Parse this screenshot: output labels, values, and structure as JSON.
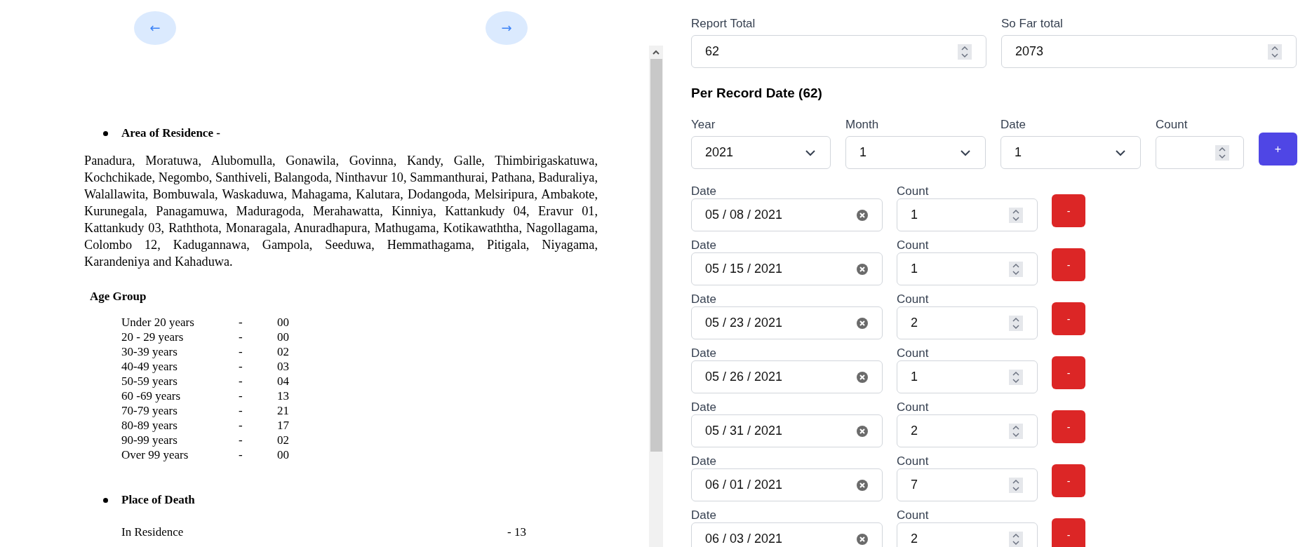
{
  "nav": {
    "prev": "←",
    "next": "→"
  },
  "document": {
    "residence": {
      "heading": "Area of Residence -",
      "text": "Panadura, Moratuwa, Alubomulla, Gonawila, Govinna, Kandy, Galle, Thimbirigaskatuwa, Kochchikade, Negombo, Santhiveli, Balangoda, Ninthavur 10, Sammanthurai, Pathana, Baduraliya, Walallawita, Bombuwala, Waskaduwa, Mahagama, Kalutara, Dodangoda, Melsiripura, Ambakote, Kurunegala, Panagamuwa, Maduragoda, Merahawatta, Kinniya, Kattankudy 04, Eravur 01, Kattankudy 03, Raththota, Monaragala, Anuradhapura, Mathugama, Kotikawaththa, Nagollagama, Colombo 12, Kadugannawa, Gampola, Seeduwa, Hemmathagama, Pitigala, Niyagama, Karandeniya and Kahaduwa."
    },
    "age_group": {
      "heading": "Age Group",
      "rows": [
        {
          "label": "Under 20 years",
          "dash": "-",
          "value": "00"
        },
        {
          "label": "20 - 29 years",
          "dash": "-",
          "value": "00"
        },
        {
          "label": "30-39 years",
          "dash": "-",
          "value": "02"
        },
        {
          "label": "40-49 years",
          "dash": "-",
          "value": "03"
        },
        {
          "label": "50-59 years",
          "dash": "-",
          "value": "04"
        },
        {
          "label": "60 -69 years",
          "dash": "-",
          "value": "13"
        },
        {
          "label": "70-79 years",
          "dash": "-",
          "value": "21"
        },
        {
          "label": "80-89 years",
          "dash": "-",
          "value": "17"
        },
        {
          "label": "90-99 years",
          "dash": "-",
          "value": "02"
        },
        {
          "label": "Over 99 years",
          "dash": "-",
          "value": "00"
        }
      ]
    },
    "place_of_death": {
      "heading": "Place of Death",
      "rows": [
        {
          "label": "In Residence",
          "value": "- 13"
        }
      ]
    }
  },
  "form": {
    "totals": [
      {
        "label": "Report Total",
        "value": "62"
      },
      {
        "label": "So Far total",
        "value": "2073"
      }
    ],
    "section_title": "Per Record Date (62)",
    "new_entry": {
      "fields": [
        {
          "kind": "select",
          "label": "Year",
          "value": "2021"
        },
        {
          "kind": "select",
          "label": "Month",
          "value": "1"
        },
        {
          "kind": "select",
          "label": "Date",
          "value": "1"
        },
        {
          "kind": "number",
          "label": "Count"
        }
      ],
      "add_button": "+"
    },
    "records": [
      {
        "date_label": "Date",
        "date": "05 / 08 / 2021",
        "count_label": "Count",
        "count": "1",
        "remove_button": "-"
      },
      {
        "date_label": "Date",
        "date": "05 / 15 / 2021",
        "count_label": "Count",
        "count": "1",
        "remove_button": "-"
      },
      {
        "date_label": "Date",
        "date": "05 / 23 / 2021",
        "count_label": "Count",
        "count": "2",
        "remove_button": "-"
      },
      {
        "date_label": "Date",
        "date": "05 / 26 / 2021",
        "count_label": "Count",
        "count": "1",
        "remove_button": "-"
      },
      {
        "date_label": "Date",
        "date": "05 / 31 / 2021",
        "count_label": "Count",
        "count": "2",
        "remove_button": "-"
      },
      {
        "date_label": "Date",
        "date": "06 / 01 / 2021",
        "count_label": "Count",
        "count": "7",
        "remove_button": "-"
      },
      {
        "date_label": "Date",
        "date": "06 / 03 / 2021",
        "count_label": "Count",
        "count": "2",
        "remove_button": "-"
      }
    ]
  }
}
